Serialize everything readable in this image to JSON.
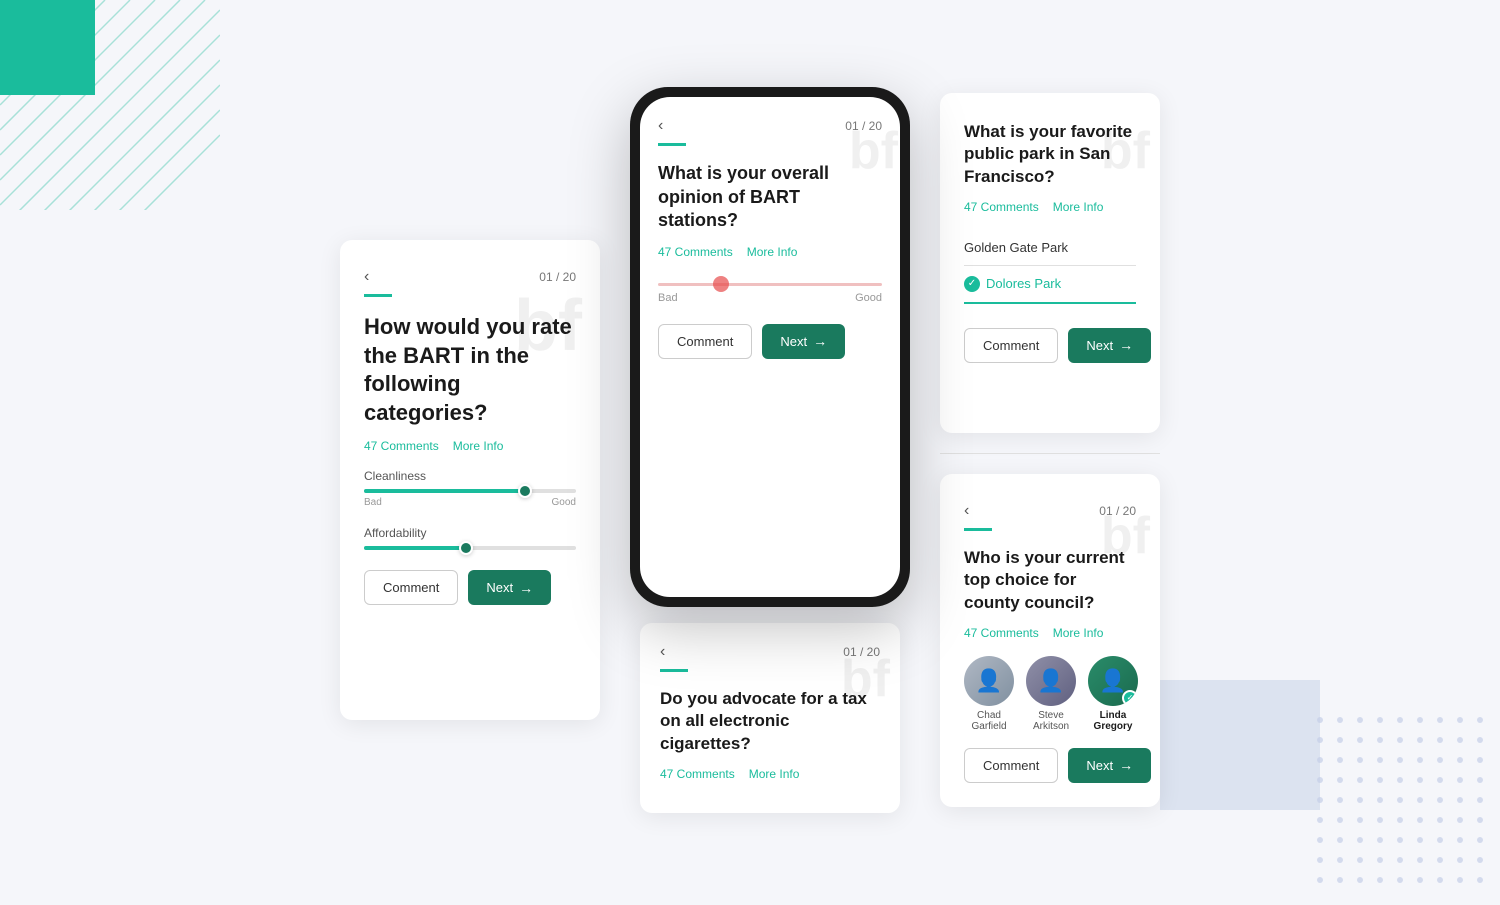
{
  "background": {
    "teal_square": "teal square decoration",
    "teal_lines": "teal diagonal lines decoration",
    "blue_dots": "blue dots pattern decoration",
    "blue_rect": "blue rectangle decoration"
  },
  "left_card": {
    "back_label": "‹",
    "page_num": "01 / 20",
    "watermark": "bf",
    "question": "How would you rate the BART in the following categories?",
    "comments_count": "47 Comments",
    "more_info": "More Info",
    "sliders": [
      {
        "label": "Cleanliness",
        "fill_pct": 76,
        "bad_label": "Bad",
        "good_label": "Good"
      },
      {
        "label": "Affordability",
        "fill_pct": 48,
        "bad_label": "",
        "good_label": ""
      }
    ],
    "comment_btn": "Comment",
    "next_btn": "Next"
  },
  "center_phone": {
    "back_label": "‹",
    "page_num": "01 / 20",
    "watermark": "bf",
    "question": "What is your overall opinion of BART stations?",
    "comments_count": "47 Comments",
    "more_info": "More Info",
    "slider_bad": "Bad",
    "slider_good": "Good",
    "comment_btn": "Comment",
    "next_btn": "Next"
  },
  "bottom_phone_card": {
    "back_label": "‹",
    "page_num": "01 / 20",
    "watermark": "bf",
    "question": "Do you advocate for a tax on all electronic cigarettes?",
    "comments_count": "47 Comments",
    "more_info": "More Info"
  },
  "right_top_card": {
    "back_label": "",
    "page_num": "",
    "watermark": "bf",
    "question": "What is your favorite public park in San Francisco?",
    "comments_count": "47 Comments",
    "more_info": "More Info",
    "options": [
      {
        "label": "Golden Gate Park",
        "selected": false
      },
      {
        "label": "Dolores Park",
        "selected": true
      }
    ],
    "comment_btn": "Comment",
    "next_btn": "Next"
  },
  "right_bottom_card": {
    "back_label": "‹",
    "page_num": "01 / 20",
    "watermark": "bf",
    "question": "Who is your current top choice for county council?",
    "comments_count": "47 Comments",
    "more_info": "More Info",
    "candidates": [
      {
        "name": "Chad\nGarfield",
        "selected": false,
        "color": "chad"
      },
      {
        "name": "Steve\nArkitson",
        "selected": false,
        "color": "steve"
      },
      {
        "name": "Linda\nGregory",
        "selected": true,
        "color": "linda"
      }
    ],
    "comment_btn": "Comment",
    "next_btn": "Next"
  }
}
